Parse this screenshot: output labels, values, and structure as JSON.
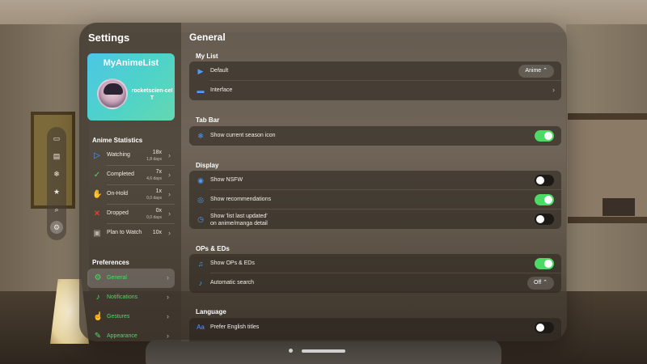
{
  "sidebar": {
    "title": "Settings",
    "profile": {
      "brand": "MyAnimeList",
      "username": "rocketscien-ceIT"
    },
    "stats_title": "Anime Statistics",
    "stats": [
      {
        "label": "Watching",
        "count": "18x",
        "days": "1,8 days",
        "icon": "play-icon",
        "color": "#4d9cff"
      },
      {
        "label": "Completed",
        "count": "7x",
        "days": "4,6 days",
        "icon": "checkmark-icon",
        "color": "#4cd964"
      },
      {
        "label": "On-Hold",
        "count": "1x",
        "days": "0,0 days",
        "icon": "hand-icon",
        "color": "#ff9f0a"
      },
      {
        "label": "Dropped",
        "count": "0x",
        "days": "0,0 days",
        "icon": "x-mark-icon",
        "color": "#ff453a"
      },
      {
        "label": "Plan to Watch",
        "count": "10x",
        "days": "",
        "icon": "calendar-icon",
        "color": "#b8b0a4"
      }
    ],
    "prefs_title": "Preferences",
    "prefs": [
      {
        "label": "General",
        "icon": "gear-icon"
      },
      {
        "label": "Notifications",
        "icon": "bell-icon"
      },
      {
        "label": "Gestures",
        "icon": "hand-tap-icon"
      },
      {
        "label": "Appearance",
        "icon": "paintbrush-icon"
      }
    ]
  },
  "main": {
    "title": "General",
    "my_list": {
      "header": "My List",
      "default_label": "Default",
      "default_value": "Anime ⌃",
      "interface_label": "Interface"
    },
    "tab_bar": {
      "header": "Tab Bar",
      "season_label": "Show current season icon",
      "season_on": true
    },
    "display": {
      "header": "Display",
      "nsfw_label": "Show NSFW",
      "nsfw_on": false,
      "recs_label": "Show recommendations",
      "recs_on": true,
      "updated_line1": "Show 'list last updated'",
      "updated_line2": "on anime/manga detail",
      "updated_on": false
    },
    "ops": {
      "header": "OPs & EDs",
      "show_label": "Show OPs & EDs",
      "show_on": true,
      "search_label": "Automatic search",
      "search_value": "Off ⌃"
    },
    "language": {
      "header": "Language",
      "english_label": "Prefer English titles",
      "english_on": false
    }
  },
  "ornament": [
    "tv-icon",
    "book-icon",
    "snowflake-icon",
    "star-icon",
    "search-icon",
    "gear-icon"
  ],
  "colors": {
    "accent_green": "#4cd964",
    "accent_blue": "#4d9cff"
  }
}
